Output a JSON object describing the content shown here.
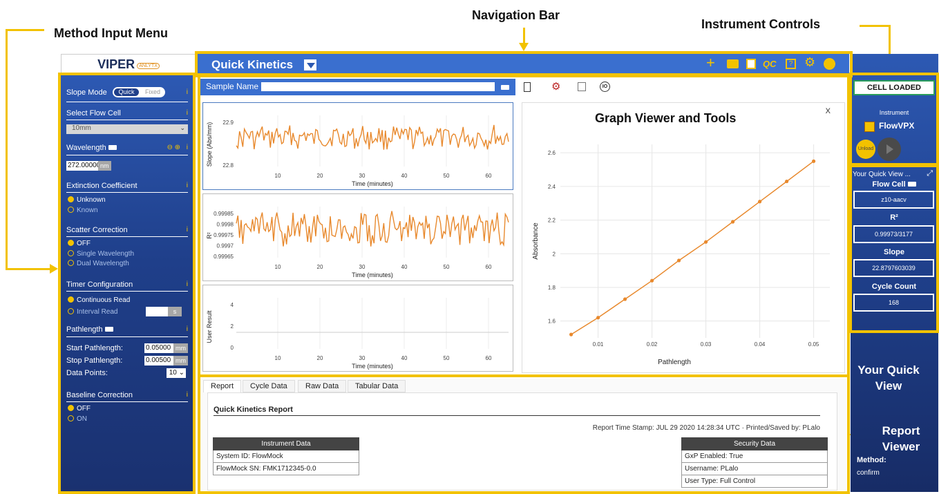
{
  "annotations": {
    "method_input_menu": "Method Input Menu",
    "navigation_bar": "Navigation Bar",
    "instrument_controls": "Instrument Controls",
    "graph_viewer": "Graph Viewer and Tools",
    "your_quick_view": "Your Quick View",
    "report_viewer": "Report Viewer"
  },
  "logo": {
    "main": "VIPER",
    "sub": "ANLYTX"
  },
  "nav": {
    "title": "Quick Kinetics"
  },
  "left": {
    "slope_mode": {
      "label": "Slope Mode",
      "options": [
        "Quick",
        "Fixed"
      ],
      "selected": "Quick"
    },
    "flow_cell": {
      "label": "Select Flow Cell",
      "value": "10mm"
    },
    "wavelength": {
      "label": "Wavelength",
      "value": "272.00000",
      "unit": "nm"
    },
    "extinction": {
      "label": "Extinction Coefficient",
      "options": [
        "Unknown",
        "Known"
      ]
    },
    "scatter": {
      "label": "Scatter Correction",
      "options": [
        "OFF",
        "Single Wavelength",
        "Dual Wavelength"
      ]
    },
    "timer": {
      "label": "Timer Configuration",
      "options": [
        "Continuous Read",
        "Interval Read"
      ],
      "interval_unit": "s"
    },
    "pathlength": {
      "label": "Pathlength",
      "start_label": "Start Pathlength:",
      "start_value": "0.05000",
      "start_unit": "mm",
      "stop_label": "Stop Pathlength:",
      "stop_value": "0.00500",
      "stop_unit": "mm",
      "points_label": "Data Points:",
      "points_value": "10"
    },
    "baseline": {
      "label": "Baseline Correction",
      "options": [
        "OFF",
        "ON"
      ]
    }
  },
  "sample": {
    "label": "Sample Name"
  },
  "charts": {
    "slope": {
      "ylabel": "Slope (Abs/mm)",
      "yticks": [
        "22.9",
        "22.8"
      ],
      "xticks": [
        "10",
        "20",
        "30",
        "40",
        "50",
        "60"
      ],
      "xlabel": "Time (minutes)"
    },
    "r2": {
      "ylabel": "R²",
      "yticks": [
        "0.99985",
        "0.9998",
        "0.99975",
        "0.9997",
        "0.99965"
      ],
      "xticks": [
        "10",
        "20",
        "30",
        "40",
        "50",
        "60"
      ],
      "xlabel": "Time (minutes)"
    },
    "user": {
      "ylabel": "User Result",
      "yticks": [
        "4",
        "2",
        "0"
      ],
      "xticks": [
        "10",
        "20",
        "30",
        "40",
        "50",
        "60"
      ],
      "xlabel": "Time (minutes)"
    }
  },
  "chart_data": {
    "type": "line",
    "title": "",
    "xlabel": "Pathlength",
    "ylabel": "Absorbance",
    "x": [
      0.005,
      0.01,
      0.015,
      0.02,
      0.025,
      0.03,
      0.035,
      0.04,
      0.045,
      0.05
    ],
    "values": [
      1.52,
      1.62,
      1.73,
      1.84,
      1.96,
      2.07,
      2.19,
      2.31,
      2.43,
      2.55
    ],
    "xticks": [
      "0.01",
      "0.02",
      "0.03",
      "0.04",
      "0.05"
    ],
    "yticks": [
      "1.6",
      "1.8",
      "2",
      "2.2",
      "2.4",
      "2.6"
    ],
    "xlim": [
      0.003,
      0.053
    ],
    "ylim": [
      1.5,
      2.65
    ],
    "grid": true,
    "color": "#e8892d"
  },
  "graph_close": "X",
  "instrument": {
    "status": "CELL LOADED",
    "label": "Instrument",
    "name": "FlowVPX",
    "unload": "Unload"
  },
  "quick_view": {
    "header": "Your Quick View ...",
    "flow_cell_label": "Flow Cell",
    "flow_cell_value": "z10-aacv",
    "r2_label": "R²",
    "r2_value": "0.99973/3177",
    "slope_label": "Slope",
    "slope_value": "22.8797603039",
    "cycle_label": "Cycle Count",
    "cycle_value": "168",
    "method_label": "Method:",
    "method_value": "confirm"
  },
  "report": {
    "tabs": [
      "Report",
      "Cycle Data",
      "Raw Data",
      "Tabular Data"
    ],
    "title": "Quick Kinetics Report",
    "stamp": "Report Time Stamp: JUL 29 2020 14:28:34 UTC · Printed/Saved by: PLalo",
    "instrument_header": "Instrument Data",
    "instrument_rows": [
      "System ID: FlowMock",
      "FlowMock SN: FMK1712345-0.0"
    ],
    "security_header": "Security Data",
    "security_rows": [
      "GxP Enabled: True",
      "Username: PLalo",
      "User Type: Full Control"
    ]
  },
  "colors": {
    "accent": "#f2c200",
    "nav": "#3a6fcf",
    "panel": "#1f3f8a",
    "line": "#e8892d"
  }
}
